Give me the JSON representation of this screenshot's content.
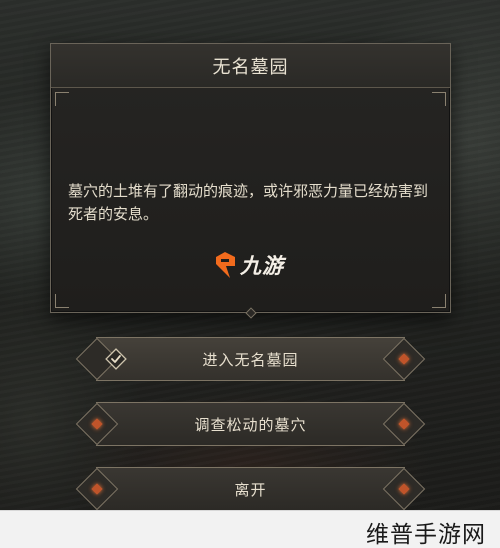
{
  "dialog": {
    "title": "无名墓园",
    "description": "墓穴的土堆有了翻动的痕迹，或许邪恶力量已经妨害到死者的安息。"
  },
  "watermark": {
    "text": "九游"
  },
  "choices": [
    {
      "label": "进入无名墓园",
      "icon": "check-icon"
    },
    {
      "label": "调查松动的墓穴"
    },
    {
      "label": "离开"
    }
  ],
  "footer": {
    "text": "维普手游网"
  },
  "colors": {
    "accent_gem": "#c0542a",
    "text": "#e4ddcc",
    "border": "#7d7464",
    "logo_orange": "#f26b1d"
  }
}
